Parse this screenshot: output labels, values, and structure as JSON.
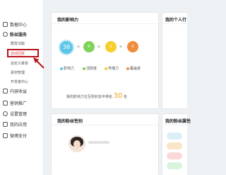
{
  "sidebar": {
    "items": [
      {
        "label": "数据中心"
      },
      {
        "label": "粉丝服务"
      },
      {
        "label": "内容收益"
      },
      {
        "label": "营销推广"
      },
      {
        "label": "设置管理"
      },
      {
        "label": "我的应用"
      },
      {
        "label": "微博支付"
      }
    ],
    "sub_items": [
      {
        "label": "群发功能"
      },
      {
        "label": "自动回复"
      },
      {
        "label": "自定义菜单"
      },
      {
        "label": "素材管理"
      },
      {
        "label": "开发者中心"
      }
    ]
  },
  "influence_card": {
    "title": "我的影响力",
    "score": "38",
    "metrics": [
      {
        "value": "0",
        "label": "影响力",
        "color": "#5cc6e9"
      },
      {
        "value": "0",
        "label": "活跃度",
        "color": "#7fd35a"
      },
      {
        "value": "0",
        "label": "传播力",
        "color": "#f6cf2a"
      },
      {
        "value": "0",
        "label": "覆盖度",
        "color": "#f08d3c"
      }
    ],
    "rank_prefix": "我的影响力在互粉好友中排名",
    "rank_value": "30",
    "rank_suffix": "名"
  },
  "personal_card": {
    "title": "我的个人行"
  },
  "gender_card": {
    "title": "我的粉丝性别"
  },
  "attr_card": {
    "title": "我的粉丝属性"
  },
  "colors": {
    "highlight": "#b8131a",
    "accent_orange": "#f0a11c"
  }
}
